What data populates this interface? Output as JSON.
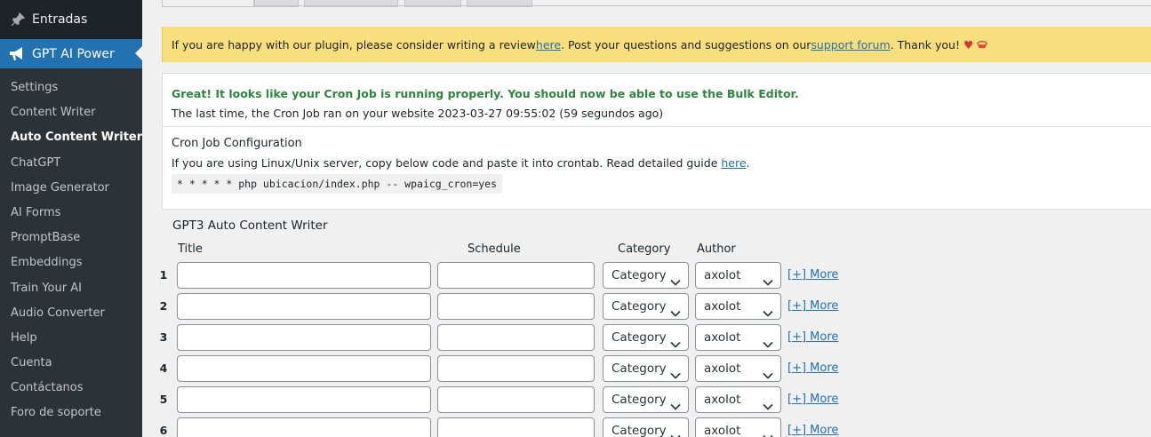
{
  "sidebar": {
    "top_item": {
      "label": "Entradas",
      "icon": "pin-icon"
    },
    "active_item": {
      "label": "GPT AI Power",
      "icon": "megaphone-icon"
    },
    "submenu": [
      "Settings",
      "Content Writer",
      "Auto Content Writer",
      "ChatGPT",
      "Image Generator",
      "AI Forms",
      "PromptBase",
      "Embeddings",
      "Train Your AI",
      "Audio Converter",
      "Help",
      "Cuenta",
      "Contáctanos",
      "Foro de soporte"
    ],
    "current_index": 2
  },
  "notice": {
    "text_before": "If you are happy with our plugin, please consider writing a review ",
    "link1": "here",
    "text_mid": ". Post your questions and suggestions on our ",
    "link2": "support forum",
    "text_after": ". Thank you!",
    "heart": "♥",
    "kiss": "💋"
  },
  "cron": {
    "status": "Great! It looks like your Cron Job is running properly. You should now be able to use the Bulk Editor.",
    "last_run": "The last time, the Cron Job ran on your website 2023-03-27 09:55:02 (59 segundos ago)",
    "config_title": "Cron Job Configuration",
    "guide_text": "If you are using Linux/Unix server, copy below code and paste it into crontab. Read detailed guide ",
    "guide_link": "here",
    "guide_end": ".",
    "code": "* * * * * php ubicacion/index.php -- wpaicg_cron=yes"
  },
  "form": {
    "title": "GPT3 Auto Content Writer",
    "columns": {
      "title": "Title",
      "schedule": "Schedule",
      "category": "Category",
      "author": "Author"
    },
    "rows": [
      {
        "num": "1",
        "category": "Category",
        "author": "axolot",
        "more": "[+] More"
      },
      {
        "num": "2",
        "category": "Category",
        "author": "axolot",
        "more": "[+] More"
      },
      {
        "num": "3",
        "category": "Category",
        "author": "axolot",
        "more": "[+] More"
      },
      {
        "num": "4",
        "category": "Category",
        "author": "axolot",
        "more": "[+] More"
      },
      {
        "num": "5",
        "category": "Category",
        "author": "axolot",
        "more": "[+] More"
      },
      {
        "num": "6",
        "category": "Category",
        "author": "axolot",
        "more": "[+] More"
      }
    ]
  },
  "colors": {
    "sidebar_bg": "#2c3338",
    "accent": "#2271b1",
    "notice_bg": "#f6df7c",
    "success": "#2e8540"
  }
}
